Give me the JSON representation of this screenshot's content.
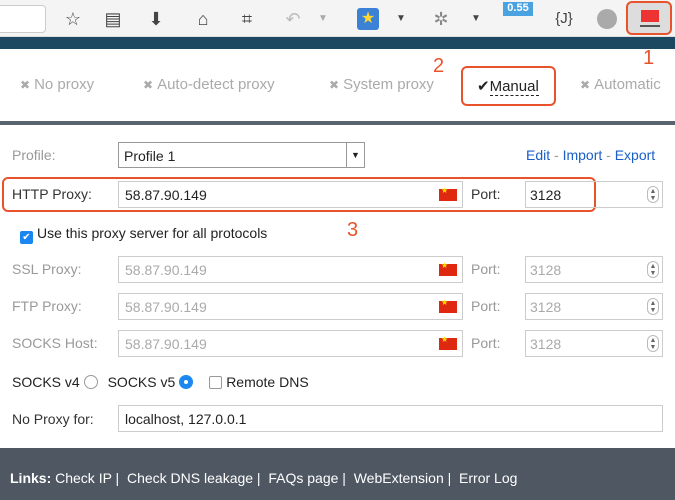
{
  "toolbar": {
    "badge": "0.55",
    "json_label": "{J}",
    "icons": [
      "star-icon",
      "reading-list-icon",
      "download-icon",
      "home-icon",
      "crop-icon",
      "undo-icon",
      "chevron-down-icon",
      "bookmark-star-icon",
      "chevron-down-icon",
      "bug-icon",
      "chevron-down-icon",
      "badge-extension-icon",
      "json-icon",
      "globe-icon",
      "proxy-monitor-icon"
    ]
  },
  "annotations": {
    "one": "1",
    "two": "2",
    "three": "3"
  },
  "modes": [
    {
      "label": "No proxy",
      "mark": "✖"
    },
    {
      "label": "Auto-detect proxy",
      "mark": "✖"
    },
    {
      "label": "System proxy",
      "mark": "✖"
    },
    {
      "label": "Manual",
      "mark": "✔",
      "selected": true
    },
    {
      "label": "Automatic",
      "mark": "✖"
    }
  ],
  "profile": {
    "label": "Profile:",
    "value": "Profile 1",
    "edit": "Edit",
    "import": "Import",
    "export": "Export",
    "sep": " - "
  },
  "http": {
    "label": "HTTP Proxy:",
    "value": "58.87.90.149",
    "port_label": "Port:",
    "port": "3128"
  },
  "all_protocols": {
    "label": "Use this proxy server for all protocols",
    "checked": true
  },
  "ssl": {
    "label": "SSL Proxy:",
    "value": "58.87.90.149",
    "port_label": "Port:",
    "port": "3128"
  },
  "ftp": {
    "label": "FTP Proxy:",
    "value": "58.87.90.149",
    "port_label": "Port:",
    "port": "3128"
  },
  "socks": {
    "label": "SOCKS Host:",
    "value": "58.87.90.149",
    "port_label": "Port:",
    "port": "3128"
  },
  "socks_version": {
    "v4": "SOCKS v4",
    "v5": "SOCKS v5",
    "selected": "v5",
    "remote_dns": "Remote DNS",
    "remote_dns_checked": false
  },
  "no_proxy": {
    "label": "No Proxy for:",
    "value": "localhost, 127.0.0.1"
  },
  "footer": {
    "prefix": "Links:",
    "links": [
      "Check IP",
      "Check DNS leakage",
      "FAQs page",
      "WebExtension",
      "Error Log"
    ]
  },
  "colors": {
    "accent": "#e8532b",
    "header_strip": "#1c4862",
    "footer": "#4f5862",
    "link": "#1a5ec8"
  }
}
